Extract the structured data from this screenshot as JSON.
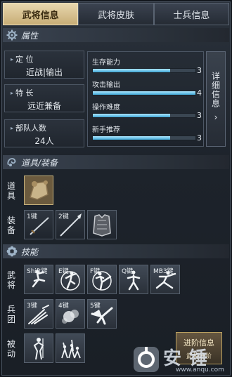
{
  "tabs": [
    {
      "label": "武将信息",
      "active": true
    },
    {
      "label": "武将皮肤",
      "active": false
    },
    {
      "label": "士兵信息",
      "active": false
    }
  ],
  "sections": {
    "attributes": "属性",
    "items": "道具/装备",
    "skills": "技能"
  },
  "attributes": [
    {
      "label": "定 位",
      "value": "近战|输出"
    },
    {
      "label": "特 长",
      "value": "远近兼备"
    },
    {
      "label": "部队人数",
      "value": "24人"
    }
  ],
  "stats": [
    {
      "name": "生存能力",
      "value": 3,
      "max": 4
    },
    {
      "name": "攻击输出",
      "value": 4,
      "max": 4
    },
    {
      "name": "操作难度",
      "value": 3,
      "max": 4
    },
    {
      "name": "新手推荐",
      "value": 3,
      "max": 4
    }
  ],
  "detail_button": {
    "label": "详细信息",
    "arrow": "›"
  },
  "row_labels": {
    "props": "道具",
    "equip": "装备",
    "hero": "武将",
    "troop": "兵团",
    "passive": "被动"
  },
  "equip_slots": [
    {
      "key": "1键",
      "icon": "sword-icon"
    },
    {
      "key": "2键",
      "icon": "spear-icon"
    },
    {
      "key": "",
      "icon": "armor-icon"
    }
  ],
  "hero_skills": [
    {
      "key": "Shift键",
      "icon": "dash-icon"
    },
    {
      "key": "E键",
      "icon": "whirl-icon"
    },
    {
      "key": "F键",
      "icon": "kick-icon"
    },
    {
      "key": "Q键",
      "icon": "stance-icon"
    },
    {
      "key": "MB3键",
      "icon": "lunge-icon"
    }
  ],
  "troop_skills": [
    {
      "key": "3键",
      "icon": "claw-icon"
    },
    {
      "key": "4键",
      "icon": "smoke-icon"
    },
    {
      "key": "5键",
      "icon": "eagle-icon"
    }
  ],
  "passive_skills": [
    {
      "key": "",
      "icon": "monk-icon"
    },
    {
      "key": "",
      "icon": "squad-icon"
    }
  ],
  "advance_button": {
    "label": "进阶信息",
    "sub": "武将进阶"
  },
  "watermark": {
    "brand": "安 锤",
    "url": "www.anqu.com"
  },
  "colors": {
    "accent": "#d8c28f",
    "bar": "#3fa7d6",
    "panel": "#1d232b"
  }
}
